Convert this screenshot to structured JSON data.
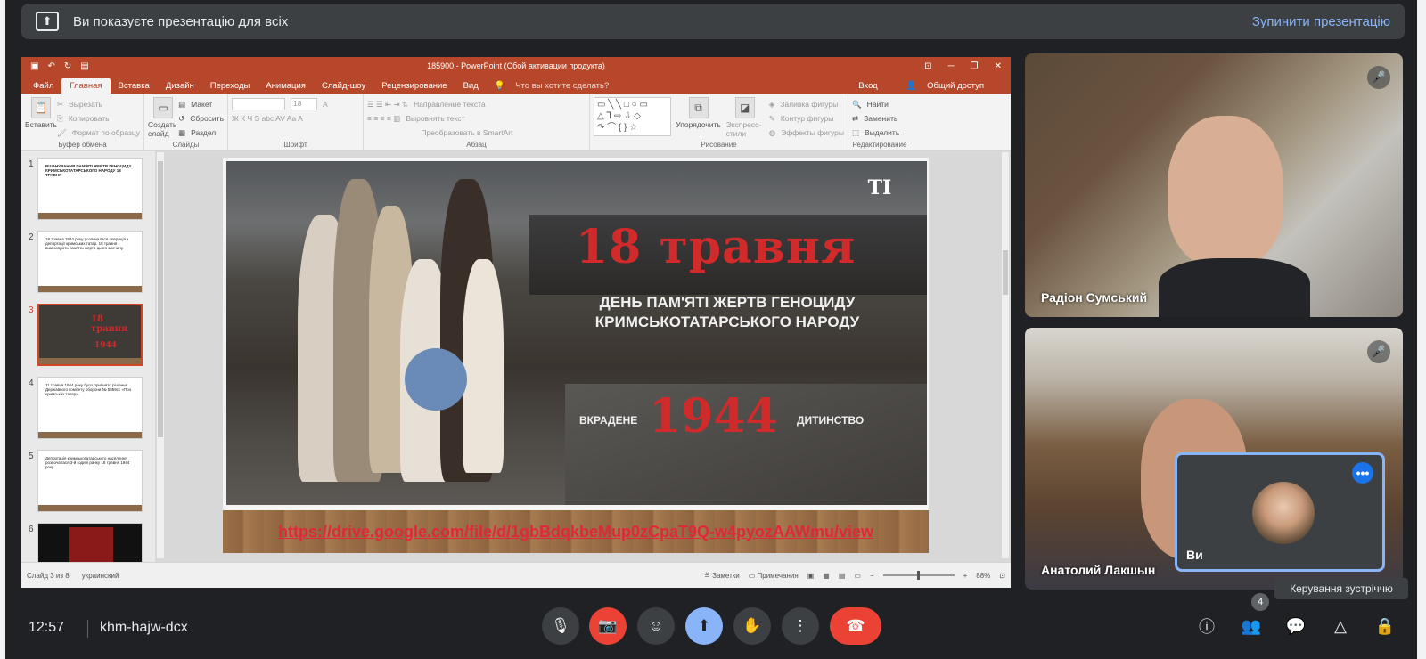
{
  "banner": {
    "message": "Ви показуєте презентацію для всіх",
    "stop": "Зупинити презентацію"
  },
  "ppt": {
    "window_title": "185900 - PowerPoint (Сбой активации продукта)",
    "tabs": [
      "Файл",
      "Главная",
      "Вставка",
      "Дизайн",
      "Переходы",
      "Анимация",
      "Слайд-шоу",
      "Рецензирование",
      "Вид"
    ],
    "tell_me": "Что вы хотите сделать?",
    "login": "Вход",
    "share": "Общий доступ",
    "ribbon": {
      "clipboard": {
        "paste": "Вставить",
        "cut": "Вырезать",
        "copy": "Копировать",
        "format": "Формат по образцу",
        "label": "Буфер обмена"
      },
      "slides": {
        "new": "Создать слайд",
        "layout": "Макет",
        "reset": "Сбросить",
        "section": "Раздел",
        "label": "Слайды"
      },
      "font": {
        "size": "18",
        "label": "Шрифт"
      },
      "paragraph": {
        "dir": "Направление текста",
        "align": "Выровнять текст",
        "smartart": "Преобразовать в SmartArt",
        "label": "Абзац"
      },
      "drawing": {
        "arrange": "Упорядочить",
        "styles": "Экспресс-стили",
        "fill": "Заливка фигуры",
        "outline": "Контур фигуры",
        "effects": "Эффекты фигуры",
        "label": "Рисование"
      },
      "editing": {
        "find": "Найти",
        "replace": "Заменить",
        "select": "Выделить",
        "label": "Редактирование"
      }
    },
    "thumbs": [
      {
        "num": "1",
        "text": "ВШАНУВАННЯ ПАМ'ЯТІ ЖЕРТВ ГЕНОЦИДУ КРИМСЬКОТАТАРСЬКОГО НАРОДУ 18 ТРАВНЯ"
      },
      {
        "num": "2",
        "text": "18 травня 1944 року розпочалася операція з депортації кримських татар. 18 травня вшановують пам'ять жертв цього злочину."
      },
      {
        "num": "3",
        "text": ""
      },
      {
        "num": "4",
        "text": "11 травня 1944 року було прийнято рішення Державного комітету оборони № 5859сс «Про кримських татар»."
      },
      {
        "num": "5",
        "text": "Депортація кримськотатарського населення розпочалася 3-й годині ранку 18 травня 1944 року."
      },
      {
        "num": "6",
        "text": ""
      }
    ],
    "slide": {
      "logo": "ТΙ",
      "date": "18 травня",
      "subtitle": "ДЕНЬ ПАМ'ЯТІ ЖЕРТВ ГЕНОЦИДУ КРИМСЬКОТАТАРСЬКОГО НАРОДУ",
      "left_word": "ВКРАДЕНЕ",
      "year": "1944",
      "right_word": "ДИТИНСТВО",
      "link": "https://drive.google.com/file/d/1gbBdqkbeMup0zCpaT9Q-w4pyozAAWmu/view"
    },
    "status": {
      "slide": "Слайд 3 из 8",
      "lang": "украинский",
      "notes": "Заметки",
      "comments": "Примечания",
      "zoom": "88%"
    }
  },
  "participants": [
    {
      "name": "Радіон Сумський",
      "muted": true
    },
    {
      "name": "Анатолий Лакшын",
      "muted": true
    }
  ],
  "self_label": "Ви",
  "tooltip": "Керування зустріччю",
  "bottom": {
    "time": "12:57",
    "code": "khm-hajw-dcx",
    "people_count": "4"
  }
}
